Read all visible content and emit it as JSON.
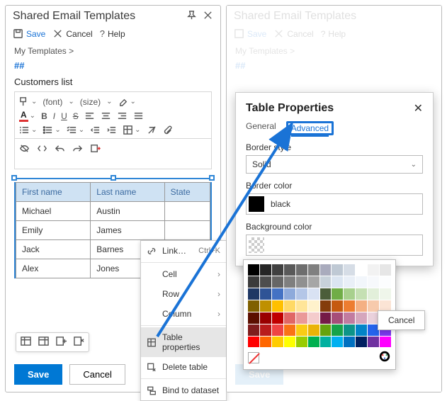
{
  "left": {
    "title": "Shared Email Templates",
    "toolbar": {
      "save": "Save",
      "cancel": "Cancel",
      "help": "Help"
    },
    "breadcrumb": "My Templates >",
    "hash": "##",
    "subject": "Customers list",
    "fontLabel": "(font)",
    "sizeLabel": "(size)",
    "btnSave": "Save",
    "btnCancel": "Cancel",
    "table": {
      "headers": [
        "First name",
        "Last name",
        "State"
      ],
      "rows": [
        [
          "Michael",
          "Austin",
          ""
        ],
        [
          "Emily",
          "James",
          ""
        ],
        [
          "Jack",
          "Barnes",
          ""
        ],
        [
          "Alex",
          "Jones",
          ""
        ]
      ]
    },
    "ctx": {
      "link": "Link…",
      "linkShort": "Ctrl+K",
      "cell": "Cell",
      "row": "Row",
      "column": "Column",
      "tableProps": "Table properties",
      "delete": "Delete table",
      "bind": "Bind to dataset"
    }
  },
  "right": {
    "title": "Shared Email Templates",
    "toolbar": {
      "save": "Save",
      "cancel": "Cancel",
      "help": "Help"
    },
    "breadcrumb": "My Templates >",
    "hash": "##"
  },
  "dlg": {
    "title": "Table Properties",
    "tabGeneral": "General",
    "tabAdvanced": "Advanced",
    "borderStyle": "Border style",
    "borderStyleVal": "Solid",
    "borderColor": "Border color",
    "borderColorVal": "black",
    "bgColor": "Background color",
    "bgColorVal": ""
  },
  "palette": {
    "cancel": "Cancel",
    "colors": [
      "#000000",
      "#262626",
      "#404040",
      "#595959",
      "#6e6e6e",
      "#808080",
      "#a9abbd",
      "#bfc9d4",
      "#d6dde6",
      "#ffffff",
      "#f2f2f2",
      "#e6e6e6",
      "#3b3b3b",
      "#4d4d4d",
      "#666666",
      "#7f7f7f",
      "#909090",
      "#a6a6a6",
      "#c7d1da",
      "#dbe5f1",
      "#e9eff7",
      "#f2f6fb",
      "#f7f9fc",
      "#fcfdfe",
      "#1f3864",
      "#2f5496",
      "#4472c4",
      "#8eaadb",
      "#b4c6e7",
      "#d9e2f3",
      "#4b5d3a",
      "#70ad47",
      "#a8d08d",
      "#c5e0b3",
      "#e2efda",
      "#eff6ea",
      "#7f6000",
      "#bf9000",
      "#ffc000",
      "#ffd966",
      "#ffe599",
      "#fff2cc",
      "#843c0b",
      "#c55a11",
      "#ed7d31",
      "#f4b083",
      "#f7caac",
      "#fbe4d5",
      "#5b0f00",
      "#990000",
      "#c00000",
      "#e06666",
      "#ea9999",
      "#f4cccc",
      "#741b47",
      "#a64d79",
      "#c27ba0",
      "#d5a6bd",
      "#ead1dc",
      "#f2e0e9",
      "#7f1d1d",
      "#b91c1c",
      "#ef4444",
      "#f97316",
      "#facc15",
      "#eab308",
      "#65a30d",
      "#16a34a",
      "#0d9488",
      "#0284c7",
      "#2563eb",
      "#7c3aed",
      "#ff0000",
      "#ff6600",
      "#ffcc00",
      "#ffff00",
      "#99cc00",
      "#00b050",
      "#00b0a0",
      "#00b0f0",
      "#0070c0",
      "#002060",
      "#7030a0",
      "#ff00ff"
    ]
  }
}
